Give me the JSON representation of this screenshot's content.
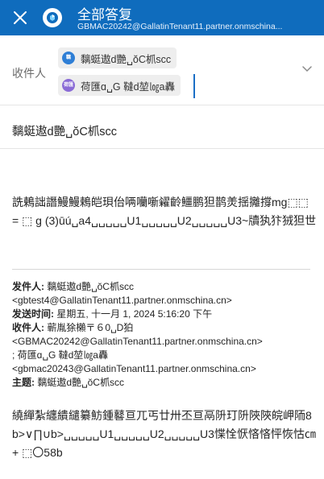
{
  "header": {
    "close_icon": "close-icon",
    "app_icon": "copilot-logo-icon",
    "title": "全部答复",
    "account": "GBMAC20242@GallatinTenant11.partner.onmschina..."
  },
  "recipients": {
    "label": "收件人",
    "chips": [
      {
        "initials": "黐",
        "name": "黐蜓遨d艷␣ŏC枛scc",
        "color": "#2f7fd6"
      },
      {
        "initials": "荷匯",
        "name": "荷匯ɑ␣G 韃d堃㏒a轟",
        "color": "#8a6bd6"
      }
    ],
    "expand_icon": "chevron-down-icon"
  },
  "subject": "黐蜓遨d艷␣ŏC枛scc",
  "body_para1": "詵鶫詘譖鰻鰻鵣皑珼佁唡囒噺糴齡䲔鹏狚鹊羙揺攡撐mg⬚⬚ = ⬚ g (3)ūú␣a4␣␣␣␣␣U1␣␣␣␣␣U2␣␣␣␣␣U3~牘犱犿狨狚世",
  "quoted": {
    "from_label": "发件人:",
    "from_value": "黐蜓遨d艷␣ŏC枛scc",
    "from_email": "<gbtest4@GallatinTenant11.partner.onmschina.cn>",
    "sent_label": "发送时间:",
    "sent_value": "星期五, 十一月 1, 2024 5:16:20 下午",
    "to_label": "收件人:",
    "to_value": "蕲胤狳櫴〒６0␣D狛",
    "to_line2": "<GBMAC20242@GallatinTenant11.partner.onmschina.cn>",
    "to_line3": "; 荷匯ɑ␣G 韃d堃㏒a轟",
    "to_line4": "<gbmac20243@GallatinTenant11.partner.onmschina.cn>",
    "subject_label": "主题:",
    "subject_value": "黐蜓遨d艷␣ŏC枛scc"
  },
  "body_para2": "繞繟紮纏繢繾纂魴鍾鼛亘兀丐廿卅丕亘鬲阩玎阩陜陜皖岬陑8b>∨∏∪b>␣␣␣␣␣U1␣␣␣␣␣U2␣␣␣␣␣U3惵恮恹悋悋怦恢怙㎝ + ⬚〇58b",
  "colors": {
    "header_bg": "#0f6cbd",
    "caret": "#1b6fc6"
  }
}
